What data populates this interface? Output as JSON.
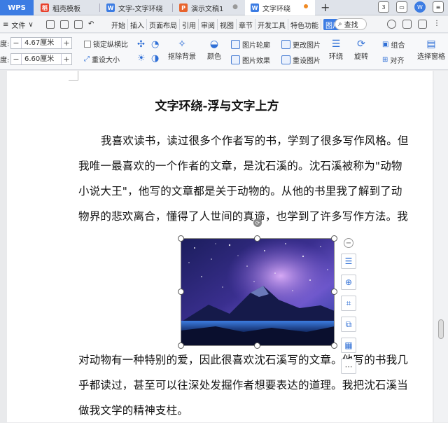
{
  "tabs": {
    "wps": "WPS",
    "items": [
      {
        "label": "稻壳模板",
        "icon": "daoke-icon"
      },
      {
        "label": "文字-文字环绕",
        "icon": "writer-doc-icon"
      },
      {
        "label": "演示文稿1",
        "icon": "presentation-icon"
      },
      {
        "label": "文字环绕",
        "icon": "writer-doc-icon"
      }
    ],
    "new_tab": "+",
    "window_badge": "3"
  },
  "menu": {
    "file": "文件",
    "items": [
      "开始",
      "插入",
      "页面布局",
      "引用",
      "审阅",
      "视图",
      "章节",
      "开发工具",
      "特色功能"
    ],
    "active": "图片工具",
    "search": "查找"
  },
  "toolbar": {
    "height_label": "高度:",
    "height_value": "4.67厘米",
    "width_label": "宽度:",
    "width_value": "6.60厘米",
    "lock_ratio": "锁定纵横比",
    "reset_size": "重设大小",
    "remove_bg": "抠除背景",
    "color": "颜色",
    "outline": "图片轮廓",
    "effects": "图片效果",
    "change_pic": "更改图片",
    "reset_pic": "重设图片",
    "wrap": "环绕",
    "rotate": "旋转",
    "group": "组合",
    "align": "对齐",
    "selection_pane": "选择窗格"
  },
  "document": {
    "title": "文字环绕-浮与文字上方",
    "paragraph1": [
      "我喜欢读书，读过很多个作者写的书，学到了很多写作风格。但",
      "我唯一最喜欢的一个作者的文章，是沈石溪的。沈石溪被称为\"动物",
      "小说大王\"，他写的文章都是关于动物的。从他的书里我了解到了动",
      "物界的悲欢离合，懂得了人世间的真谛，也学到了许多写作方法。我"
    ],
    "paragraph2": [
      "对动物有一种特别的爱，因此很喜欢沈石溪写的文章。他写的书我几",
      "乎都读过，甚至可以往深处发掘作者想要表达的道理。我把沈石溪当",
      "做我文学的精神支柱。"
    ]
  },
  "image_tools": [
    "layout-options-icon",
    "zoom-icon",
    "crop-icon",
    "replace-image-icon",
    "image-convert-icon"
  ],
  "colors": {
    "accent": "#3c7ce3"
  }
}
